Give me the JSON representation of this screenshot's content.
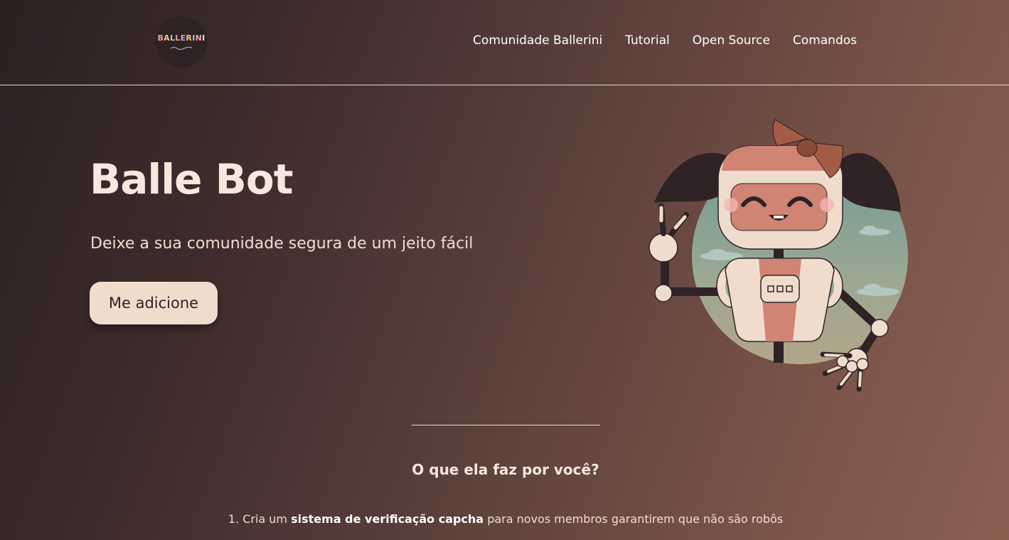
{
  "header": {
    "logo_text": "BALLERINI",
    "nav": [
      {
        "label": "Comunidade Ballerini"
      },
      {
        "label": "Tutorial"
      },
      {
        "label": "Open Source"
      },
      {
        "label": "Comandos"
      }
    ]
  },
  "hero": {
    "title": "Balle Bot",
    "subtitle": "Deixe a sua comunidade segura de um jeito fácil",
    "button_label": "Me adicione"
  },
  "features": {
    "title": "O que ela faz por você?",
    "items": [
      {
        "number": "1.",
        "prefix": "Cria um",
        "bold": "sistema de verificação capcha",
        "suffix": "para novos membros garantirem que não são robôs"
      }
    ]
  },
  "colors": {
    "background_start": "#2c2022",
    "background_end": "#8c5f53",
    "button_bg": "#f0dccd",
    "text_light": "#f6e8de"
  },
  "icons": {
    "logo": "ballerini-logo",
    "robot": "robot-illustration"
  }
}
